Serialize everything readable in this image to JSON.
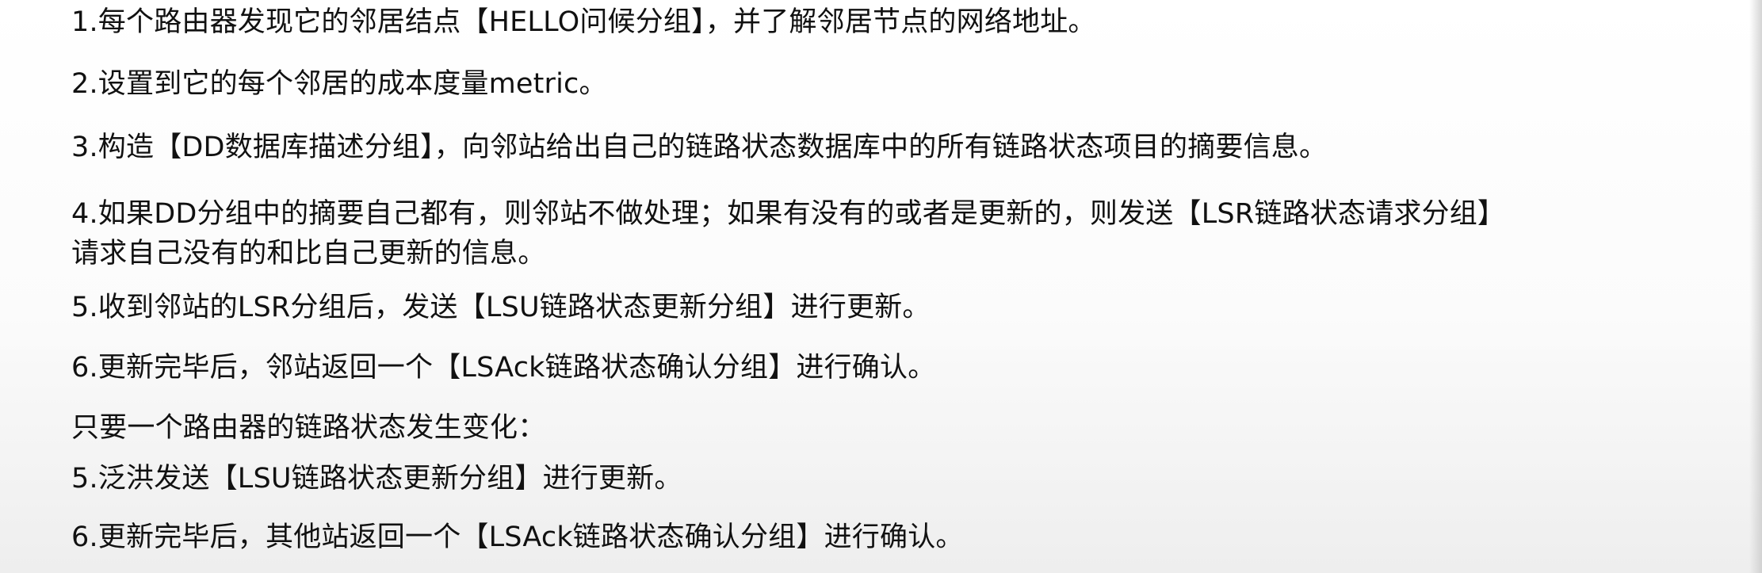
{
  "content": {
    "lines": [
      "1.每个路由器发现它的邻居结点【HELLO问候分组】，并了解邻居节点的网络地址。",
      "2.设置到它的每个邻居的成本度量metric。",
      "3.构造【DD数据库描述分组】，向邻站给出自己的链路状态数据库中的所有链路状态项目的摘要信息。",
      "4.如果DD分组中的摘要自己都有，则邻站不做处理；如果有没有的或者是更新的，则发送【LSR链路状态请求分组】",
      "请求自己没有的和比自己更新的信息。",
      "5.收到邻站的LSR分组后，发送【LSU链路状态更新分组】进行更新。",
      "6.更新完毕后，邻站返回一个【LSAck链路状态确认分组】进行确认。",
      "只要一个路由器的链路状态发生变化：",
      "5.泛洪发送【LSU链路状态更新分组】进行更新。",
      "6.更新完毕后，其他站返回一个【LSAck链路状态确认分组】进行确认。"
    ]
  },
  "colors": {
    "text": "#111111",
    "background": "#ffffff"
  }
}
